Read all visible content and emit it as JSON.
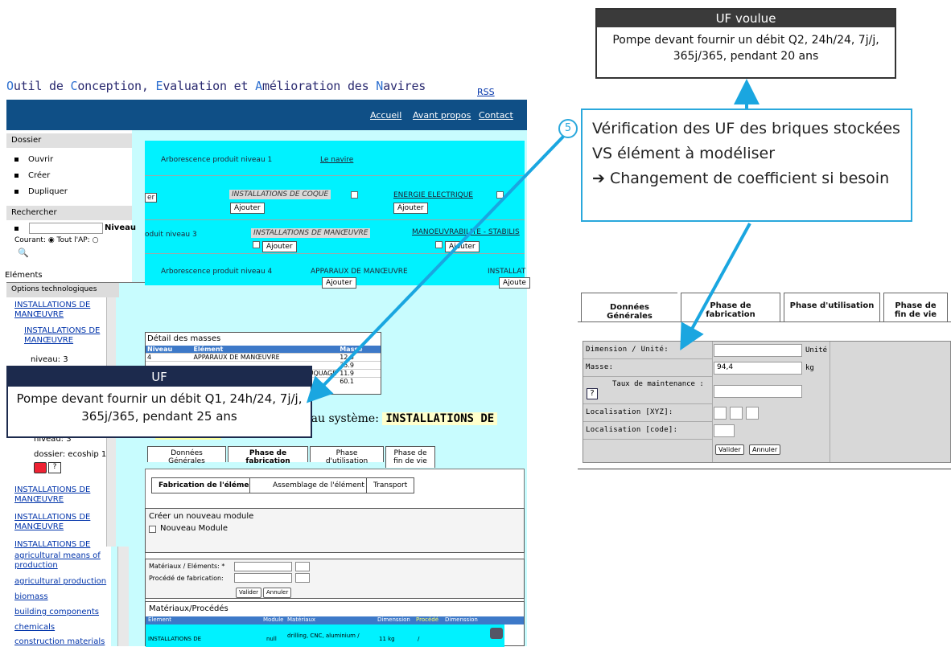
{
  "app": {
    "title_parts": [
      "O",
      "util de ",
      "C",
      "onception, ",
      "E",
      "valuation et ",
      "A",
      "mélioration des ",
      "N",
      "avires"
    ],
    "rss": "RSS",
    "nav": [
      "Accueil",
      "Avant propos",
      "Contact"
    ]
  },
  "sidebar": {
    "dossier_head": "Dossier",
    "dossier_items": [
      "Ouvrir",
      "Créer",
      "Dupliquer"
    ],
    "search_head": "Rechercher",
    "search_level_label": "Niveau",
    "search_scope": "Courant: ◉ Tout l'AP: ○",
    "elements_label": "Eléments",
    "options_head": "Options technologiques"
  },
  "tree": {
    "items_top": [
      "INSTALLATIONS DE MANŒUVRE",
      "INSTALLATIONS DE MANŒUVRE"
    ],
    "level_text": "niveau: 3",
    "level_text_2": "niveau: 3",
    "dossier_text": "dossier: ecoship 1",
    "items_mid": [
      "INSTALLATIONS DE MANŒUVRE",
      "INSTALLATIONS DE MANŒUVRE",
      "INSTALLATIONS DE"
    ],
    "categories": [
      "agricultural means of production",
      "agricultural production",
      "biomass",
      "building components",
      "chemicals",
      "construction materials"
    ]
  },
  "product_tree": {
    "level1_label": "Arborescence produit niveau 1",
    "level1_value": "Le navire",
    "level2_partial": "er",
    "level2_items": [
      "INSTALLATIONS DE COQUE",
      "ENERGIE ELECTRIQUE"
    ],
    "level3_label": "oduit niveau 3",
    "level3_items": [
      "INSTALLATIONS DE MANŒUVRE",
      "MANOEUVRABILITE - STABILIS"
    ],
    "level4_label": "Arborescence produit niveau 4",
    "level4_items": [
      "APPARAUX DE MANŒUVRE",
      "INSTALLAT"
    ],
    "add_label": "Ajouter",
    "add_label_partial": "Ajoute"
  },
  "masses": {
    "title": "Détail des masses",
    "headers": [
      "Niveau",
      "Elément",
      "Masse"
    ],
    "rows": [
      [
        "4",
        "APPARAUX DE MANŒUVRE",
        "12.3"
      ],
      [
        "",
        "",
        "35.9"
      ],
      [
        "",
        "RE MOUQUAGE",
        "11.9"
      ],
      [
        "",
        "",
        "60.1"
      ]
    ]
  },
  "system": {
    "title_prefix": "s au système:",
    "title_highlight": "INSTALLATIONS DE"
  },
  "left_tabs": [
    "Données Générales",
    "Phase de fabrication",
    "Phase d'utilisation",
    "Phase de fin de vie"
  ],
  "sub_tabs": [
    "Fabrication de l'élément",
    "Assemblage de l'élément",
    "Transport"
  ],
  "create_module": {
    "title": "Créer un nouveau module",
    "checkbox_label": "Nouveau Module"
  },
  "materials_form": {
    "field1": "Matériaux / Eléments: *",
    "field2": "Procédé de fabrication:",
    "validate": "Valider",
    "cancel": "Annuler"
  },
  "materials_table": {
    "title": "Matériaux/Procédés",
    "headers": [
      "Element",
      "Module",
      "Matériaux",
      "Dimenssion",
      "Procédé",
      "Dimenssion"
    ],
    "row": [
      "INSTALLATIONS DE",
      "null",
      "drilling, CNC, aluminium /",
      "11 kg",
      "/"
    ]
  },
  "uf_box": {
    "title": "UF",
    "text": "Pompe devant fournir un débit Q1, 24h/24, 7j/j, 365j/365, pendant 25 ans"
  },
  "uf_voulue_box": {
    "title": "UF voulue",
    "text": "Pompe devant fournir un débit Q2, 24h/24, 7j/j, 365j/365, pendant 20 ans"
  },
  "callout": {
    "number": "5",
    "line1": "Vérification des UF des briques stockées VS élément à modéliser",
    "line2": "➔ Changement de coefficient si besoin"
  },
  "right_panel": {
    "tabs": [
      "Données Générales",
      "Phase de fabrication",
      "Phase d'utilisation",
      "Phase de fin de vie"
    ],
    "fields": [
      "Dimension / Unité:",
      "Masse:",
      "Taux de maintenance :",
      "Localisation [XYZ]:",
      "Localisation [code]:"
    ],
    "unit_label": "Unité",
    "mass_value": "94,4",
    "mass_unit": "kg",
    "validate": "Valider",
    "cancel": "Annuler"
  },
  "colors": {
    "nav_bar": "#0f4f86",
    "cyan": "#00f2ff",
    "arrow": "#1aa6e0",
    "uf_header": "#1c2a4d"
  }
}
